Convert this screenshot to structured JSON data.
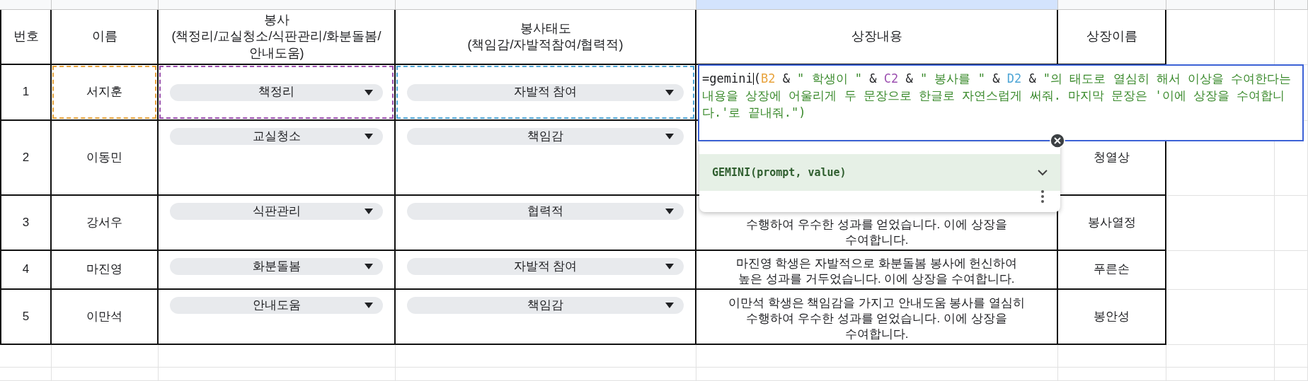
{
  "column_headers": [
    {
      "selected": false
    },
    {
      "selected": false
    },
    {
      "selected": false
    },
    {
      "selected": false
    },
    {
      "selected": true
    },
    {
      "selected": false
    },
    {
      "selected": false
    },
    {
      "selected": false
    }
  ],
  "columns": [
    "번호",
    "이름",
    "봉사\n(책정리/교실청소/식판관리/화분돌봄/안내도움)",
    "봉사태도\n(책임감/자발적참여/협력적)",
    "상장내용",
    "상장이름"
  ],
  "rows": [
    {
      "number": "1",
      "name": "서지훈",
      "service": "책정리",
      "attitude": "자발적 참여",
      "name_ref": {
        "color": "#e8a33d"
      },
      "service_ref": {
        "color": "#9c4fb0"
      },
      "attitude_ref": {
        "color": "#4fa6d6"
      }
    },
    {
      "number": "2",
      "name": "이동민",
      "service": "교실청소",
      "attitude": "책임감",
      "award_name": "청열상"
    },
    {
      "number": "3",
      "name": "강서우",
      "service": "식판관리",
      "attitude": "협력적",
      "award_text": "수행하여 우수한 성과를 얻었습니다. 이에 상장을\n수여합니다.",
      "award_name": "봉사열정"
    },
    {
      "number": "4",
      "name": "마진영",
      "service": "화분돌봄",
      "attitude": "자발적 참여",
      "award_text": "마진영 학생은 자발적으로 화분돌봄 봉사에 헌신하여\n높은 성과를 거두었습니다. 이에 상장을 수여합니다.",
      "award_name": "푸른손"
    },
    {
      "number": "5",
      "name": "이만석",
      "service": "안내도움",
      "attitude": "책임감",
      "award_text": "이만석 학생은 책임감을 가지고 안내도움 봉사를 열심히\n수행하여 우수한 성과를 얻었습니다. 이에 상장을\n수여합니다.",
      "award_name": "봉안성"
    }
  ],
  "editor": {
    "tokens": [
      {
        "kind": "plain",
        "text": "=gemini"
      },
      {
        "kind": "caret"
      },
      {
        "kind": "plain",
        "text": "("
      },
      {
        "kind": "ref",
        "text": "B2",
        "color": "#e8a33d"
      },
      {
        "kind": "plain",
        "text": " & "
      },
      {
        "kind": "string",
        "text": "\" 학생이 \""
      },
      {
        "kind": "plain",
        "text": " & "
      },
      {
        "kind": "ref",
        "text": "C2",
        "color": "#9c4fb0"
      },
      {
        "kind": "plain",
        "text": " & "
      },
      {
        "kind": "string",
        "text": "\" 봉사를 \""
      },
      {
        "kind": "plain",
        "text": " & "
      },
      {
        "kind": "ref",
        "text": "D2",
        "color": "#4fa6d6"
      },
      {
        "kind": "plain",
        "text": " & "
      },
      {
        "kind": "string",
        "text": "\"의 태도로 열심히 해서 이상을 수여한다는 내용을 상장에 어울리게 두 문장으로 한글로 자연스럽게 써줘. 마지막 문장은 '이에 상장을 수여합니다.'로 끝내줘.\""
      },
      {
        "kind": "string",
        "text": ")"
      }
    ]
  },
  "autocomplete": {
    "signature": "GEMINI(prompt, value)"
  }
}
